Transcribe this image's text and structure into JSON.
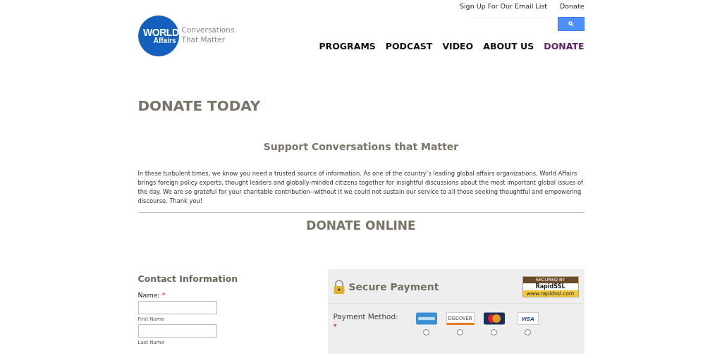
{
  "top_links": [
    "Sign Up For Our Email List",
    "Donate"
  ],
  "logo": {
    "line1": "WORLD",
    "line2": "Affairs",
    "tagline1": "Conversations",
    "tagline2": "That Matter"
  },
  "nav": [
    {
      "label": "PROGRAMS",
      "selected": false
    },
    {
      "label": "PODCAST",
      "selected": false
    },
    {
      "label": "VIDEO",
      "selected": false
    },
    {
      "label": "ABOUT US",
      "selected": false
    },
    {
      "label": "DONATE",
      "selected": true
    }
  ],
  "page_title": "DONATE TODAY",
  "subtitle": "Support Conversations that Matter",
  "intro": "In these turbulent times, we know you need a trusted source of information. As one of the country’s leading global affairs organizations, World Affairs brings foreign policy experts, thought leaders and globally-minded citizens together for insightful discussions about the most important global issues of the day. We are so grateful for your charitable contribution--without it we could not sustain our service to all those seeking thoughtful and empowering discourse. Thank you!",
  "section_title": "DONATE ONLINE",
  "contact": {
    "title": "Contact Information",
    "name_label": "Name:",
    "required_mark": "*",
    "fields": [
      {
        "caption": "First Name"
      },
      {
        "caption": "Last Name"
      }
    ]
  },
  "payment": {
    "title": "Secure Payment",
    "badge": {
      "line1": "SECURED BY",
      "line2": "RapidSSL",
      "line3": "www.rapidssl.com"
    },
    "method_label": "Payment Method:",
    "required_mark": "*",
    "cards": [
      {
        "kind": "amex",
        "selected": false
      },
      {
        "kind": "discover",
        "label": "DISCOVER",
        "selected": false
      },
      {
        "kind": "mastercard",
        "selected": false
      },
      {
        "kind": "visa",
        "label": "VISA",
        "selected": false
      }
    ]
  }
}
